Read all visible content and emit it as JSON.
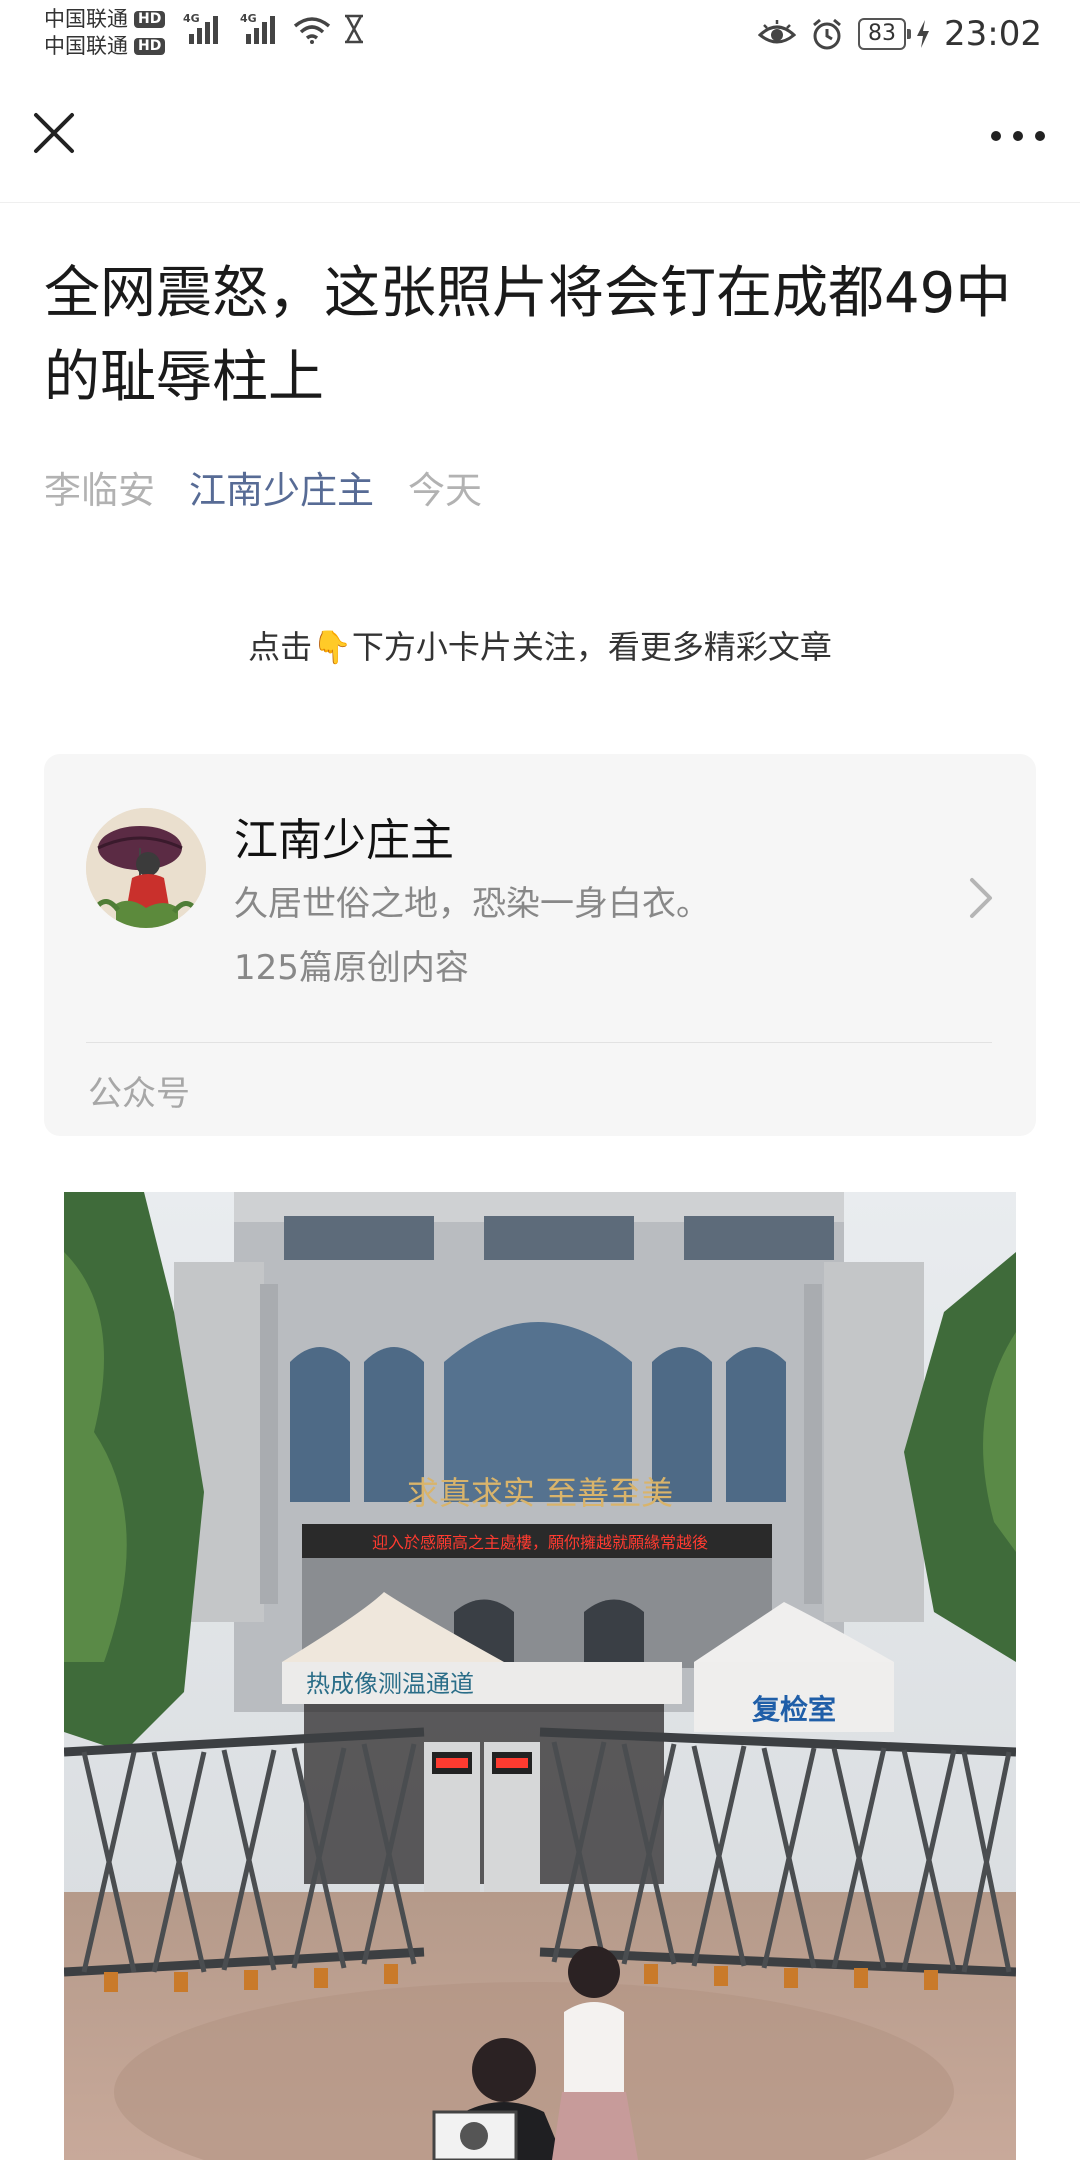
{
  "status_bar": {
    "carrier1": "中国联通",
    "carrier2": "中国联通",
    "hd_label": "HD",
    "network_label": "4G",
    "battery": "83",
    "time": "23:02"
  },
  "nav": {
    "close_icon": "close-icon",
    "more_icon": "more-dots-icon"
  },
  "article": {
    "title": "全网震怒，这张照片将会钉在成都49中的耻辱柱上",
    "author": "李临安",
    "account": "江南少庄主",
    "date": "今天",
    "tip_before": "点击",
    "tip_hand": "👇",
    "tip_after": "下方小卡片关注，看更多精彩文章"
  },
  "account_card": {
    "name": "江南少庄主",
    "description": "久居世俗之地，恐染一身白衣。",
    "count": "125篇原创内容",
    "type_label": "公众号"
  },
  "photo": {
    "sign_main": "求真求实 至善至美",
    "led_text": "迎入於感願高之主處樓，願你擁越就願緣常越後",
    "tent_left": "热成像测温通道",
    "tent_right": "复检室"
  }
}
